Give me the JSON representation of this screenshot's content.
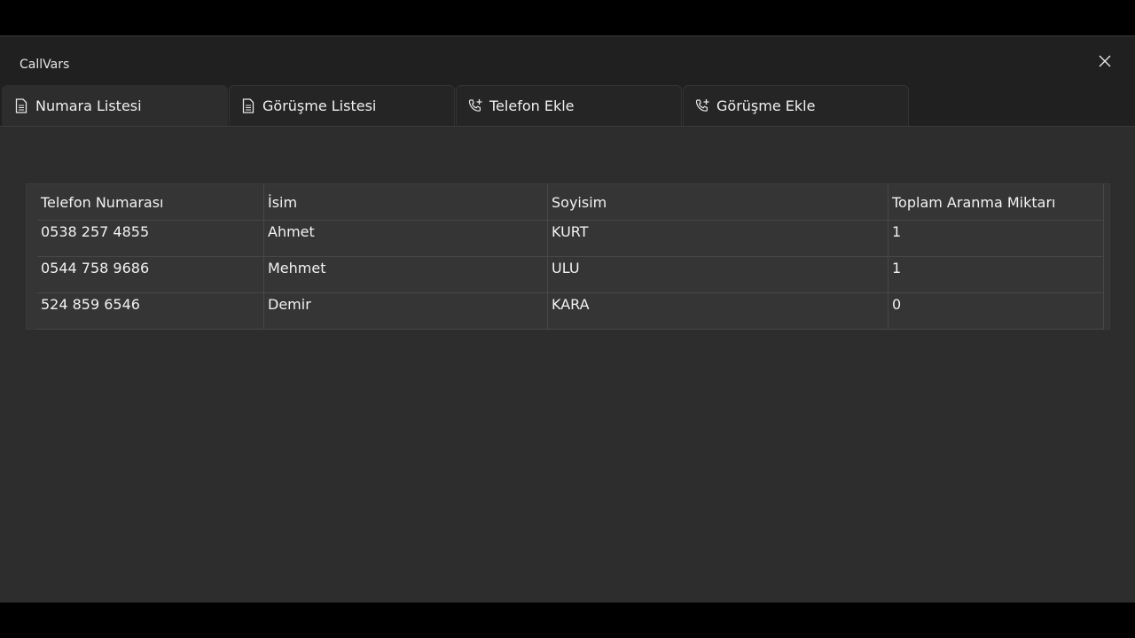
{
  "window": {
    "title": "CallVars",
    "close_icon": "close-icon"
  },
  "tabs": [
    {
      "label": "Numara Listesi",
      "icon": "document-icon",
      "active": true
    },
    {
      "label": "Görüşme Listesi",
      "icon": "document-icon",
      "active": false
    },
    {
      "label": "Telefon Ekle",
      "icon": "phone-add-icon",
      "active": false
    },
    {
      "label": "Görüşme Ekle",
      "icon": "phone-add-icon",
      "active": false
    }
  ],
  "table": {
    "columns": [
      "Telefon Numarası",
      "İsim",
      "Soyisim",
      "Toplam Aranma Miktarı"
    ],
    "rows": [
      [
        "0538 257 4855",
        "Ahmet",
        "KURT",
        "1"
      ],
      [
        "0544 758 9686",
        "Mehmet",
        "ULU",
        "1"
      ],
      [
        "524 859 6546",
        "Demir",
        "KARA",
        "0"
      ]
    ]
  }
}
